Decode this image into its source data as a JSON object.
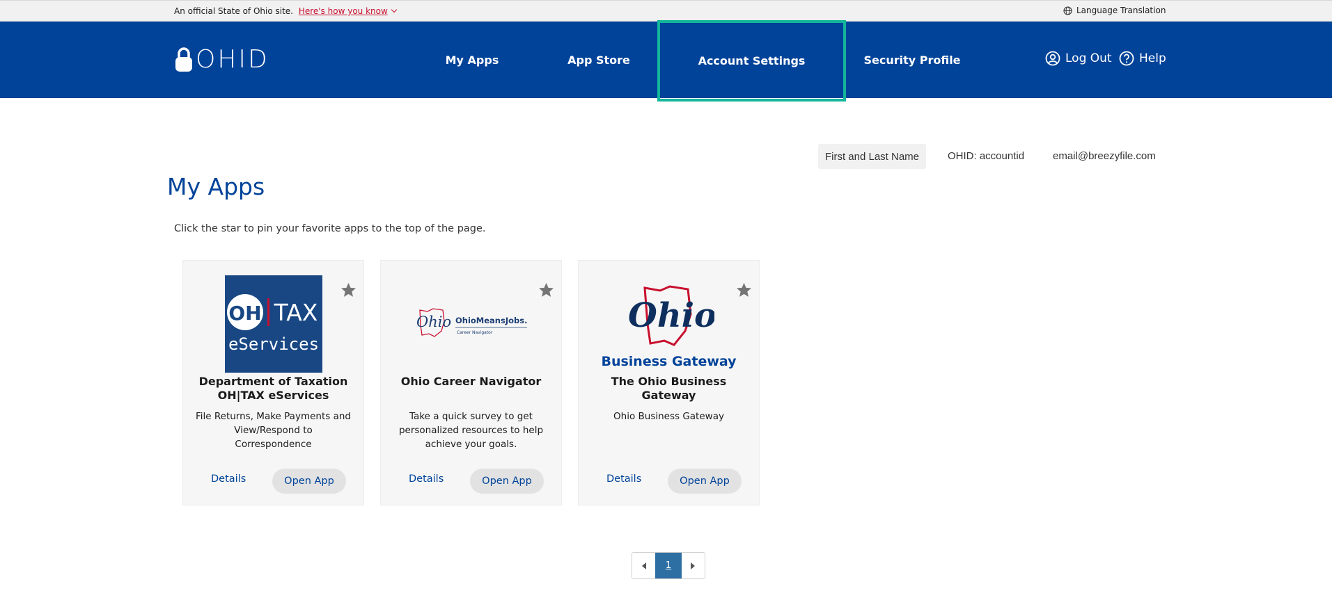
{
  "banner": {
    "official_text": "An official State of Ohio site.",
    "how_link": "Here's how you know",
    "language": "Language Translation"
  },
  "header": {
    "logo_text": "OHID",
    "nav": [
      {
        "label": "My Apps"
      },
      {
        "label": "App Store"
      },
      {
        "label": "Account Settings"
      },
      {
        "label": "Security Profile"
      }
    ],
    "logout": "Log Out",
    "help": "Help",
    "highlight_color": "#13b59b",
    "bg_color": "#004399"
  },
  "user": {
    "name": "First and Last Name",
    "ohid": "OHID:  accountid",
    "email": "email@breezyfile.com"
  },
  "main": {
    "title": "My Apps",
    "hint": "Click the star to pin your favorite apps to the top of the page."
  },
  "apps": [
    {
      "logo_icon": "oh-tax-eservices-logo",
      "logo_line1_a": "OH",
      "logo_line1_b": "TAX",
      "logo_line2": "eServices",
      "title": "Department of Taxation OH|TAX eServices",
      "description": "File Returns, Make Payments and View/Respond to Correspondence",
      "details": "Details",
      "open": "Open App"
    },
    {
      "logo_icon": "ohio-means-jobs-logo",
      "logo_script": "Ohio",
      "logo_brand": "OhioMeansJobs.",
      "logo_sub": "Career Navigator",
      "title": "Ohio Career Navigator",
      "description": "Take a quick survey to get personalized resources to help achieve your goals.",
      "details": "Details",
      "open": "Open App"
    },
    {
      "logo_icon": "ohio-business-gateway-logo",
      "logo_script": "Ohio",
      "logo_caption": "Business Gateway",
      "title": "The Ohio Business Gateway",
      "description": "Ohio Business Gateway",
      "details": "Details",
      "open": "Open App"
    }
  ],
  "pagination": {
    "current": "1"
  }
}
